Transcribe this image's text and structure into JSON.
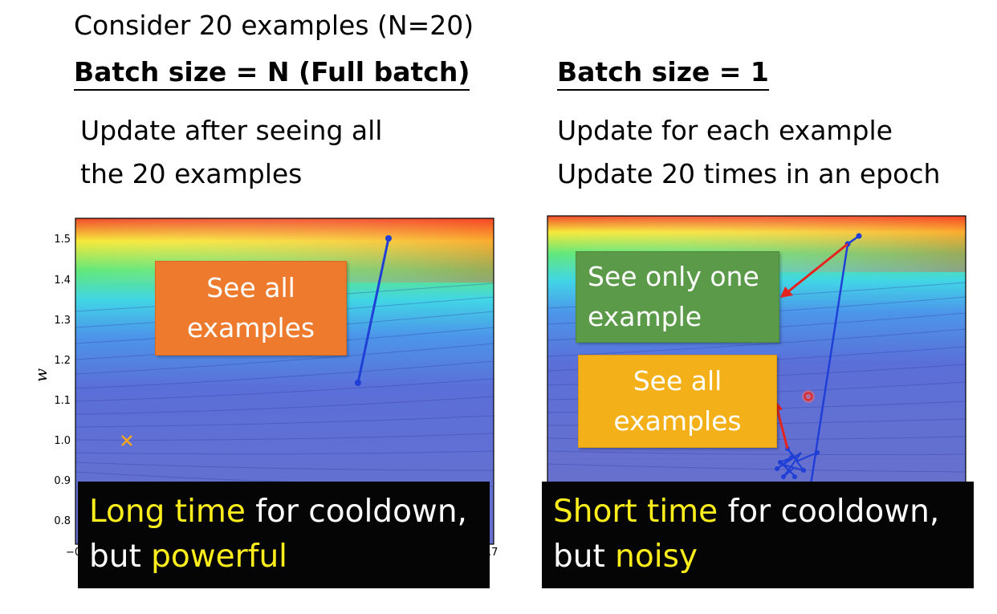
{
  "intro": "Consider 20 examples (N=20)",
  "left": {
    "heading": "Batch size = N (Full batch)",
    "desc_line1": "Update after seeing all",
    "desc_line2": "the 20 examples",
    "box_line1": "See all",
    "box_line2": "examples",
    "caption_hl1": "Long time",
    "caption_rest1": " for cooldown,",
    "caption_pre2": "but ",
    "caption_hl2": "powerful",
    "y_axis_label": "w",
    "y_ticks": [
      "1.5",
      "1.4",
      "1.3",
      "1.2",
      "1.1",
      "1.0",
      "0.9",
      "0.8"
    ],
    "x_tick_left": "−0",
    "x_tick_right": ".7"
  },
  "right": {
    "heading": "Batch size = 1",
    "desc_line1": "Update for each example",
    "desc_line2": "Update 20 times in an epoch",
    "box_one_line1": "See only one",
    "box_one_line2": "example",
    "box_all_line1": "See all",
    "box_all_line2": "examples",
    "caption_hl1": "Short time",
    "caption_rest1": " for cooldown,",
    "caption_pre2": "but ",
    "caption_hl2": "noisy"
  },
  "colors": {
    "highlight": "#ffee1c",
    "path": "#1f3fd6",
    "arrow": "#e5231e",
    "box_orange": "#ee7a2e",
    "box_green": "#5a9a48",
    "box_yellow": "#f4b019"
  }
}
